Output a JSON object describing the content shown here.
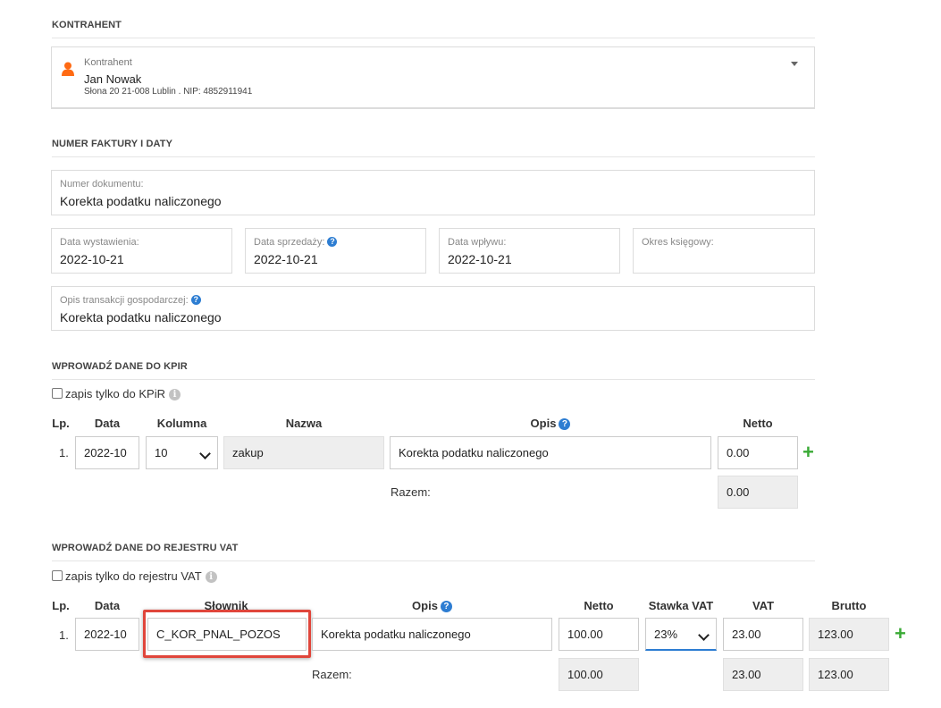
{
  "sections": {
    "contractor_title": "KONTRAHENT",
    "invoice_title": "NUMER FAKTURY I DATY",
    "kpir_title": "WPROWADŹ DANE DO KPIR",
    "vat_title": "WPROWADŹ DANE DO REJESTRU VAT"
  },
  "contractor": {
    "label": "Kontrahent",
    "name": "Jan Nowak",
    "details": "Słona 20 21-008 Lublin . NIP: 4852911941"
  },
  "invoice": {
    "doc_number_label": "Numer dokumentu:",
    "doc_number": "Korekta podatku naliczonego",
    "issue_date_label": "Data wystawienia:",
    "issue_date": "2022-10-21",
    "sale_date_label": "Data sprzedaży:",
    "sale_date": "2022-10-21",
    "receipt_date_label": "Data wpływu:",
    "receipt_date": "2022-10-21",
    "period_label": "Okres księgowy:",
    "period": "",
    "description_label": "Opis transakcji gospodarczej:",
    "description": "Korekta podatku naliczonego"
  },
  "kpir": {
    "only_checkbox_label": "zapis tylko do KPiR",
    "headers": {
      "lp": "Lp.",
      "data": "Data",
      "kolumna": "Kolumna",
      "nazwa": "Nazwa",
      "opis": "Opis",
      "netto": "Netto"
    },
    "row": {
      "lp": "1.",
      "data": "2022-10",
      "kolumna": "10",
      "nazwa": "zakup",
      "opis": "Korekta podatku naliczonego",
      "netto": "0.00"
    },
    "razem_label": "Razem:",
    "razem_netto": "0.00"
  },
  "vat": {
    "only_checkbox_label": "zapis tylko do rejestru VAT",
    "headers": {
      "lp": "Lp.",
      "data": "Data",
      "slownik": "Słownik",
      "opis": "Opis",
      "netto": "Netto",
      "stawka": "Stawka VAT",
      "vat": "VAT",
      "brutto": "Brutto"
    },
    "row": {
      "lp": "1.",
      "data": "2022-10",
      "slownik": "C_KOR_PNAL_POZOS",
      "opis": "Korekta podatku naliczonego",
      "netto": "100.00",
      "stawka": "23%",
      "vat": "23.00",
      "brutto": "123.00"
    },
    "razem_label": "Razem:",
    "razem_netto": "100.00",
    "razem_vat": "23.00",
    "razem_brutto": "123.00"
  },
  "icons": {
    "person": "person-icon",
    "help": "?",
    "info": "i",
    "plus": "+"
  },
  "colors": {
    "accent": "#2d7dd2",
    "person_icon": "#ff6a13",
    "plus": "#3aaa35",
    "highlight": "#e0463b"
  }
}
